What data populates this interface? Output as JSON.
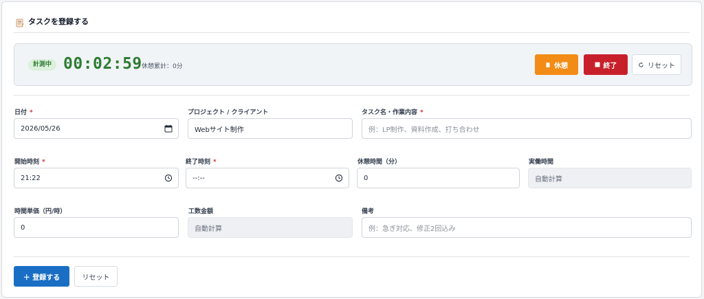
{
  "header": {
    "title": "タスクを登録する"
  },
  "timer": {
    "status_badge": "計測中",
    "elapsed": "00:02:59",
    "break_total": "休憩累計：0分",
    "break_button": "休憩",
    "end_button": "終了",
    "reset_button": "リセット"
  },
  "form": {
    "date": {
      "label": "日付",
      "required": "*",
      "value": "2026/05/26"
    },
    "project": {
      "label": "プロジェクト / クライアント",
      "value": "Webサイト制作"
    },
    "task": {
      "label": "タスク名・作業内容",
      "required": "*",
      "placeholder": "例：LP制作、資料作成、打ち合わせ"
    },
    "start_time": {
      "label": "開始時刻",
      "required": "*",
      "value": "21:22"
    },
    "end_time": {
      "label": "終了時刻",
      "required": "*",
      "value": "--:--"
    },
    "break_minutes": {
      "label": "休憩時間（分）",
      "value": "0"
    },
    "actual_time": {
      "label": "実働時間",
      "value": "自動計算"
    },
    "hourly_rate": {
      "label": "時間単価（円/時）",
      "value": "0"
    },
    "amount": {
      "label": "工数金額",
      "value": "自動計算"
    },
    "notes": {
      "label": "備考",
      "placeholder": "例：急ぎ対応、修正2回込み"
    }
  },
  "actions": {
    "submit": "＋ 登録する",
    "reset": "リセット"
  },
  "colors": {
    "accent": "#1a6fc4",
    "timer_green": "#2e7d32",
    "break_orange": "#f28c16",
    "end_red": "#c8202b"
  }
}
